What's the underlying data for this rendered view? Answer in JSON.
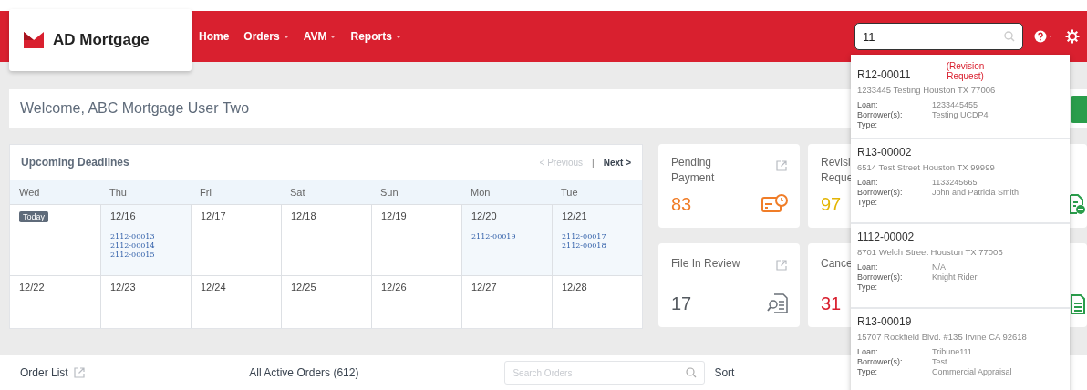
{
  "brand": {
    "name": "AD Mortgage"
  },
  "nav": [
    {
      "label": "Home",
      "has_menu": false
    },
    {
      "label": "Orders",
      "has_menu": true
    },
    {
      "label": "AVM",
      "has_menu": true
    },
    {
      "label": "Reports",
      "has_menu": true
    }
  ],
  "search": {
    "value": "11"
  },
  "welcome": "Welcome, ABC Mortgage User Two",
  "deadlines": {
    "title": "Upcoming Deadlines",
    "previous": {
      "label": "< Previous",
      "disabled": true
    },
    "separator": "|",
    "next": {
      "label": "Next >",
      "disabled": false
    },
    "days": [
      "Wed",
      "Thu",
      "Fri",
      "Sat",
      "Sun",
      "Mon",
      "Tue"
    ],
    "weeks": [
      [
        {
          "badge": "Today"
        },
        {
          "date": "12/16",
          "orders": [
            "2112-00013",
            "2112-00014",
            "2112-00015"
          ]
        },
        {
          "date": "12/17"
        },
        {
          "date": "12/18"
        },
        {
          "date": "12/19"
        },
        {
          "date": "12/20",
          "orders": [
            "2112-00019"
          ]
        },
        {
          "date": "12/21",
          "orders": [
            "2112-00017",
            "2112-00018"
          ]
        }
      ],
      [
        {
          "date": "12/22"
        },
        {
          "date": "12/23"
        },
        {
          "date": "12/24"
        },
        {
          "date": "12/25"
        },
        {
          "date": "12/26"
        },
        {
          "date": "12/27"
        },
        {
          "date": "12/28"
        }
      ]
    ]
  },
  "stats": [
    {
      "kind": "payment",
      "label_lines": [
        "Pending",
        "Payment"
      ],
      "count": "83",
      "color": "#f07d28"
    },
    {
      "kind": "covered",
      "label_lines": [
        "Revisi",
        "Reque"
      ],
      "count": "97",
      "color": "#e3b505"
    },
    {
      "kind": "revision"
    },
    {
      "kind": "review",
      "label_lines": [
        "File In Review"
      ],
      "count": "17",
      "color": "#555a60"
    },
    {
      "kind": "covered",
      "label_lines": [
        "Cance"
      ],
      "count": "31",
      "color": "#d9202f"
    },
    {
      "kind": "document"
    }
  ],
  "results": [
    {
      "id": "R12-00011",
      "status": "(Revision Request)",
      "address": "1233445 Testing Houston TX 77006",
      "loan_label": "Loan:",
      "loan": "1233445455",
      "borrower_label": "Borrower(s):",
      "borrower": "Testing UCDP4",
      "type_label": "Type:"
    },
    {
      "id": "R13-00002",
      "address": "6514 Test Street Houston TX 99999",
      "loan_label": "Loan:",
      "loan": "1133245665",
      "borrower_label": "Borrower(s):",
      "borrower": "John and Patricia Smith",
      "type_label": "Type:"
    },
    {
      "id": "1112-00002",
      "address": "8701 Welch Street Houston TX 77006",
      "loan_label": "Loan:",
      "loan": "N/A",
      "borrower_label": "Borrower(s):",
      "borrower": "Knight Rider",
      "type_label": "Type:"
    },
    {
      "id": "R13-00019",
      "address": "15707 Rockfield Blvd. #135 Irvine CA 92618",
      "loan_label": "Loan:",
      "loan": "Tribune111",
      "borrower_label": "Borrower(s):",
      "borrower": "Test",
      "type_label": "Type:",
      "type": "Commercial Appraisal"
    }
  ],
  "order_bar": {
    "title": "Order List",
    "filter": "All Active Orders (612)",
    "search_placeholder": "Search Orders",
    "sort": "Sort"
  }
}
